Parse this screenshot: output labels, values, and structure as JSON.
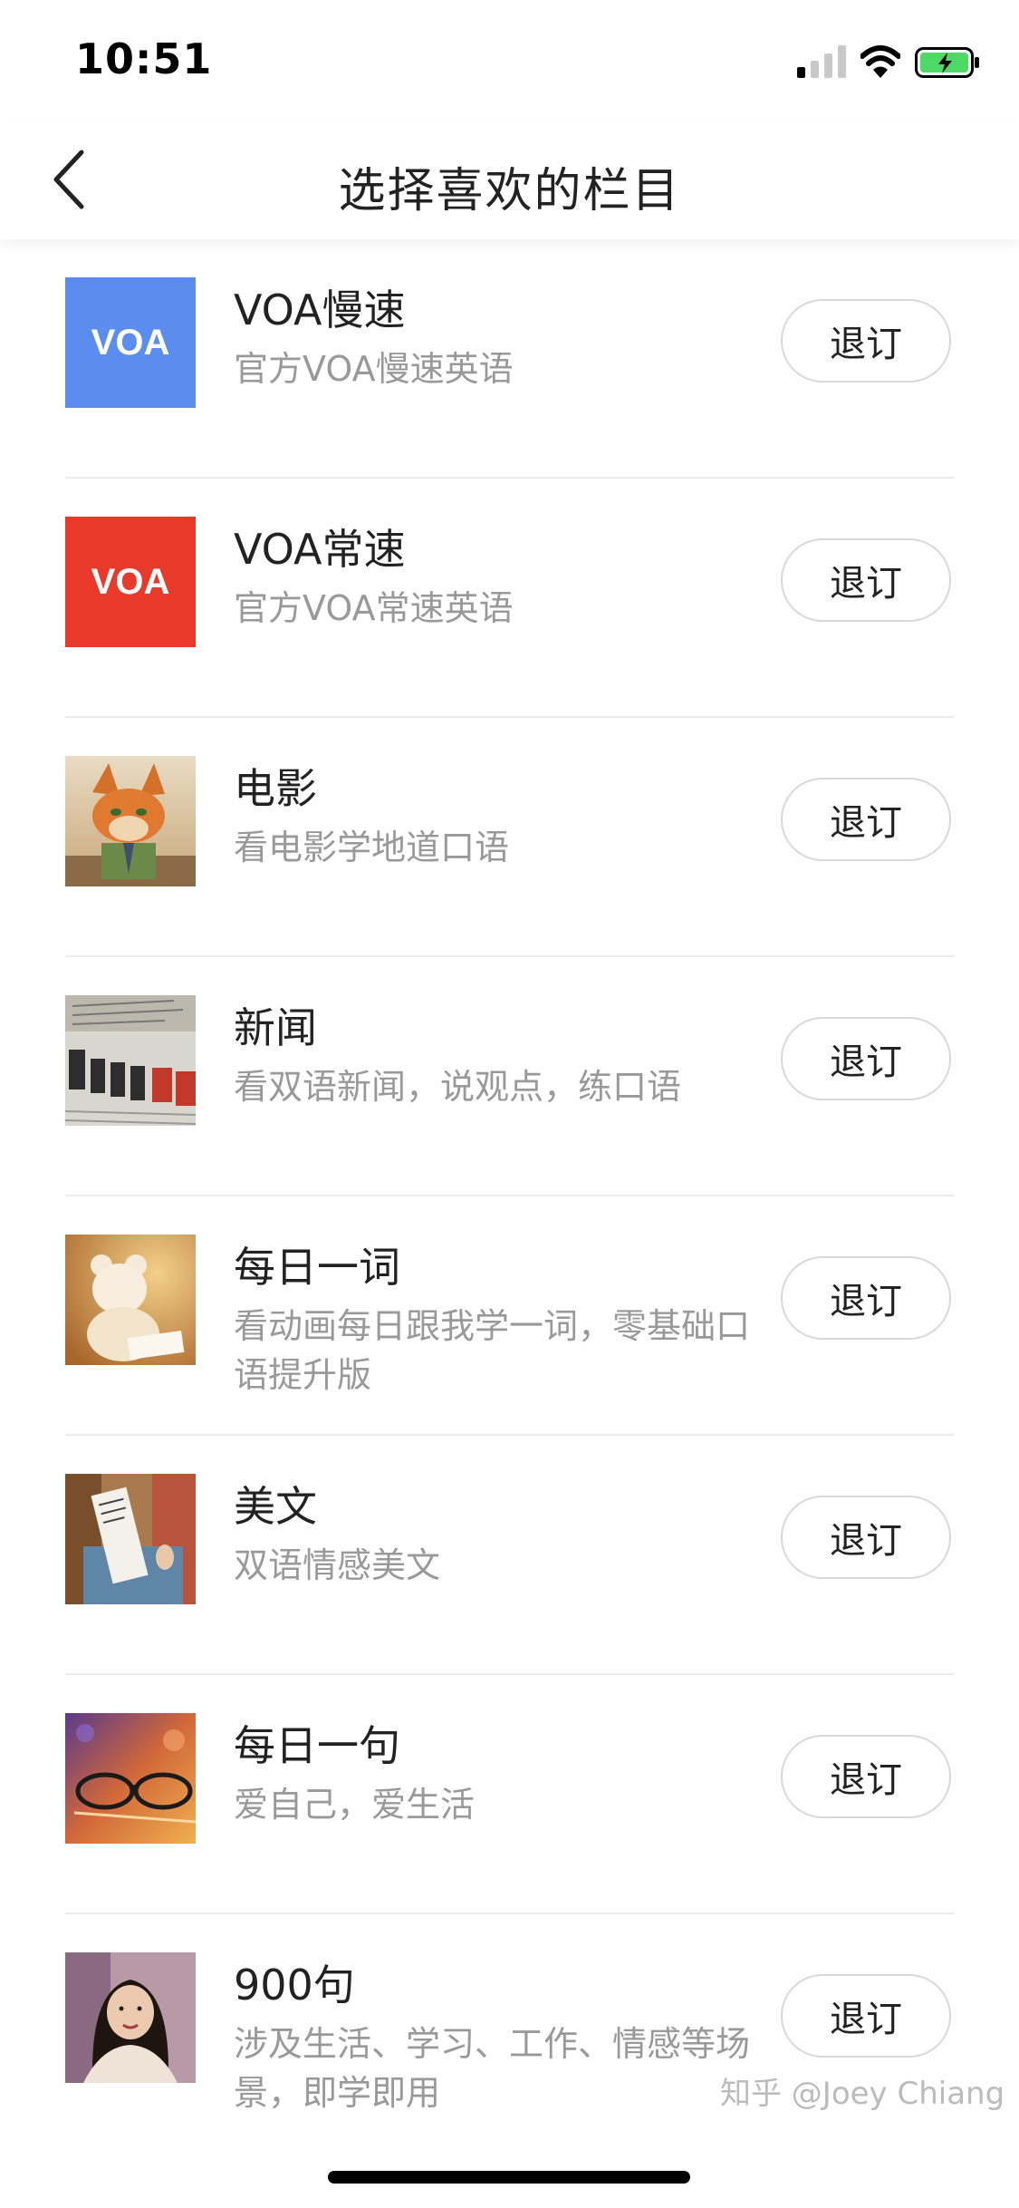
{
  "status_bar": {
    "time": "10:51"
  },
  "nav": {
    "title": "选择喜欢的栏目"
  },
  "list": {
    "items": [
      {
        "title": "VOA慢速",
        "subtitle": "官方VOA慢速英语",
        "thumb_label": "VOA",
        "thumb_color": "#5B8DEF",
        "button": "退订"
      },
      {
        "title": "VOA常速",
        "subtitle": "官方VOA常速英语",
        "thumb_label": "VOA",
        "thumb_color": "#E8392B",
        "button": "退订"
      },
      {
        "title": "电影",
        "subtitle": "看电影学地道口语",
        "button": "退订"
      },
      {
        "title": "新闻",
        "subtitle": "看双语新闻，说观点，练口语",
        "button": "退订"
      },
      {
        "title": "每日一词",
        "subtitle": "看动画每日跟我学一词，零基础口语提升版",
        "button": "退订"
      },
      {
        "title": "美文",
        "subtitle": "双语情感美文",
        "button": "退订"
      },
      {
        "title": "每日一句",
        "subtitle": "爱自己，爱生活",
        "button": "退订"
      },
      {
        "title": "900句",
        "subtitle": "涉及生活、学习、工作、情感等场景，即学即用",
        "button": "退订"
      }
    ]
  },
  "watermark": "知乎 @Joey Chiang"
}
